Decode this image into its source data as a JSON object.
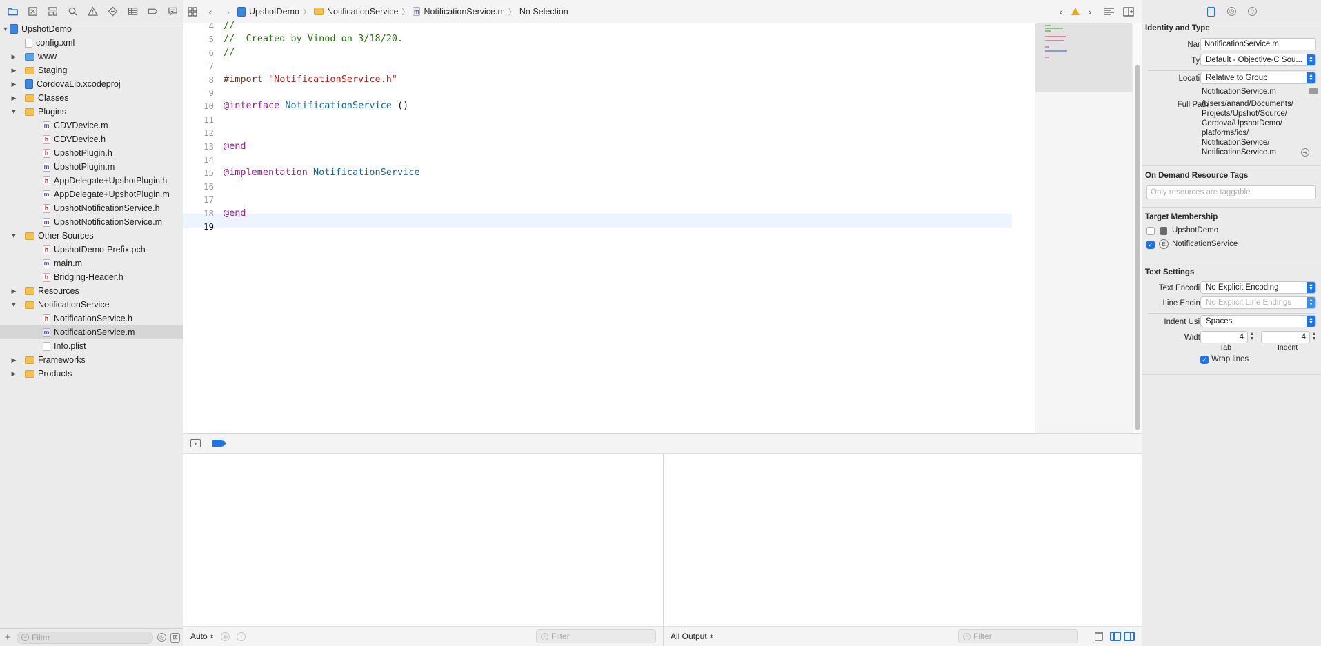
{
  "navigator": {
    "filter_placeholder": "Filter",
    "items": [
      {
        "label": "UpshotDemo",
        "depth": 0,
        "icon": "project-icon",
        "kind": "project",
        "open": true
      },
      {
        "label": "config.xml",
        "depth": 1,
        "icon": "file-icon",
        "kind": "file"
      },
      {
        "label": "www",
        "depth": 1,
        "icon": "folder-blue-icon",
        "kind": "folder-blue",
        "open": false
      },
      {
        "label": "Staging",
        "depth": 1,
        "icon": "folder-icon",
        "kind": "folder",
        "open": false
      },
      {
        "label": "CordovaLib.xcodeproj",
        "depth": 1,
        "icon": "project-icon",
        "kind": "project",
        "open": false
      },
      {
        "label": "Classes",
        "depth": 1,
        "icon": "folder-icon",
        "kind": "folder",
        "open": false
      },
      {
        "label": "Plugins",
        "depth": 1,
        "icon": "folder-icon",
        "kind": "folder",
        "open": true
      },
      {
        "label": "CDVDevice.m",
        "depth": 2,
        "icon": "m-file-icon",
        "kind": "m"
      },
      {
        "label": "CDVDevice.h",
        "depth": 2,
        "icon": "h-file-icon",
        "kind": "h"
      },
      {
        "label": "UpshotPlugin.h",
        "depth": 2,
        "icon": "h-file-icon",
        "kind": "h"
      },
      {
        "label": "UpshotPlugin.m",
        "depth": 2,
        "icon": "m-file-icon",
        "kind": "m"
      },
      {
        "label": "AppDelegate+UpshotPlugin.h",
        "depth": 2,
        "icon": "h-file-icon",
        "kind": "h"
      },
      {
        "label": "AppDelegate+UpshotPlugin.m",
        "depth": 2,
        "icon": "m-file-icon",
        "kind": "m"
      },
      {
        "label": "UpshotNotificationService.h",
        "depth": 2,
        "icon": "h-file-icon",
        "kind": "h"
      },
      {
        "label": "UpshotNotificationService.m",
        "depth": 2,
        "icon": "m-file-icon",
        "kind": "m"
      },
      {
        "label": "Other Sources",
        "depth": 1,
        "icon": "folder-icon",
        "kind": "folder",
        "open": true
      },
      {
        "label": "UpshotDemo-Prefix.pch",
        "depth": 2,
        "icon": "h-file-icon",
        "kind": "h"
      },
      {
        "label": "main.m",
        "depth": 2,
        "icon": "m-file-icon",
        "kind": "m"
      },
      {
        "label": "Bridging-Header.h",
        "depth": 2,
        "icon": "h-file-icon",
        "kind": "h"
      },
      {
        "label": "Resources",
        "depth": 1,
        "icon": "folder-icon",
        "kind": "folder",
        "open": false
      },
      {
        "label": "NotificationService",
        "depth": 1,
        "icon": "folder-icon",
        "kind": "folder",
        "open": true
      },
      {
        "label": "NotificationService.h",
        "depth": 2,
        "icon": "h-file-icon",
        "kind": "h"
      },
      {
        "label": "NotificationService.m",
        "depth": 2,
        "icon": "m-file-icon",
        "kind": "m",
        "selected": true
      },
      {
        "label": "Info.plist",
        "depth": 2,
        "icon": "file-icon",
        "kind": "file"
      },
      {
        "label": "Frameworks",
        "depth": 1,
        "icon": "folder-icon",
        "kind": "folder",
        "open": false
      },
      {
        "label": "Products",
        "depth": 1,
        "icon": "folder-icon",
        "kind": "folder",
        "open": false
      }
    ]
  },
  "jumpbar": {
    "crumbs": [
      "UpshotDemo",
      "NotificationService",
      "NotificationService.m",
      "No Selection"
    ]
  },
  "editor": {
    "current_line": "19",
    "lines": [
      {
        "num": "4",
        "tokens": [
          {
            "t": "//",
            "c": "comment"
          }
        ]
      },
      {
        "num": "5",
        "tokens": [
          {
            "t": "//  Created by Vinod on 3/18/20.",
            "c": "comment"
          }
        ]
      },
      {
        "num": "6",
        "tokens": [
          {
            "t": "//",
            "c": "comment"
          }
        ]
      },
      {
        "num": "7",
        "tokens": []
      },
      {
        "num": "8",
        "tokens": [
          {
            "t": "#import ",
            "c": "pre"
          },
          {
            "t": "\"NotificationService.h\"",
            "c": "str"
          }
        ]
      },
      {
        "num": "9",
        "tokens": []
      },
      {
        "num": "10",
        "tokens": [
          {
            "t": "@interface ",
            "c": "kw"
          },
          {
            "t": "NotificationService",
            "c": "type"
          },
          {
            "t": " ()",
            "c": "plain"
          }
        ]
      },
      {
        "num": "11",
        "tokens": []
      },
      {
        "num": "12",
        "tokens": []
      },
      {
        "num": "13",
        "tokens": [
          {
            "t": "@end",
            "c": "kw"
          }
        ]
      },
      {
        "num": "14",
        "tokens": []
      },
      {
        "num": "15",
        "tokens": [
          {
            "t": "@implementation ",
            "c": "kw"
          },
          {
            "t": "NotificationService",
            "c": "type"
          }
        ]
      },
      {
        "num": "16",
        "tokens": []
      },
      {
        "num": "17",
        "tokens": []
      },
      {
        "num": "18",
        "tokens": [
          {
            "t": "@end",
            "c": "kw"
          }
        ]
      },
      {
        "num": "19",
        "tokens": []
      }
    ]
  },
  "debug": {
    "auto_label": "Auto",
    "var_filter_placeholder": "Filter",
    "output_label": "All Output",
    "console_filter_placeholder": "Filter"
  },
  "inspector": {
    "identity_title": "Identity and Type",
    "name_label": "Name",
    "name_value": "NotificationService.m",
    "type_label": "Type",
    "type_value": "Default - Objective-C Sou...",
    "location_label": "Location",
    "location_value": "Relative to Group",
    "location_file": "NotificationService.m",
    "full_path_label": "Full Path",
    "full_path_lines": [
      "/Users/anand/Documents/",
      "Projects/Upshot/Source/",
      "Cordova/UpshotDemo/",
      "platforms/ios/",
      "NotificationService/",
      "NotificationService.m"
    ],
    "odr_title": "On Demand Resource Tags",
    "odr_placeholder": "Only resources are taggable",
    "target_title": "Target Membership",
    "targets": [
      {
        "label": "UpshotDemo",
        "checked": false
      },
      {
        "label": "NotificationService",
        "checked": true
      }
    ],
    "text_settings_title": "Text Settings",
    "encoding_label": "Text Encoding",
    "encoding_value": "No Explicit Encoding",
    "line_endings_label": "Line Endings",
    "line_endings_value": "No Explicit Line Endings",
    "indent_using_label": "Indent Using",
    "indent_using_value": "Spaces",
    "widths_label": "Widths",
    "tab_width": "4",
    "indent_width": "4",
    "tab_caption": "Tab",
    "indent_caption": "Indent",
    "wrap_label": "Wrap lines",
    "wrap_checked": true
  },
  "colors": {
    "accent": "#1d74e8",
    "comment": "#267507",
    "keyword": "#9b2393",
    "string": "#c41a16",
    "type": "#0f68a0",
    "preprocessor": "#633820"
  }
}
